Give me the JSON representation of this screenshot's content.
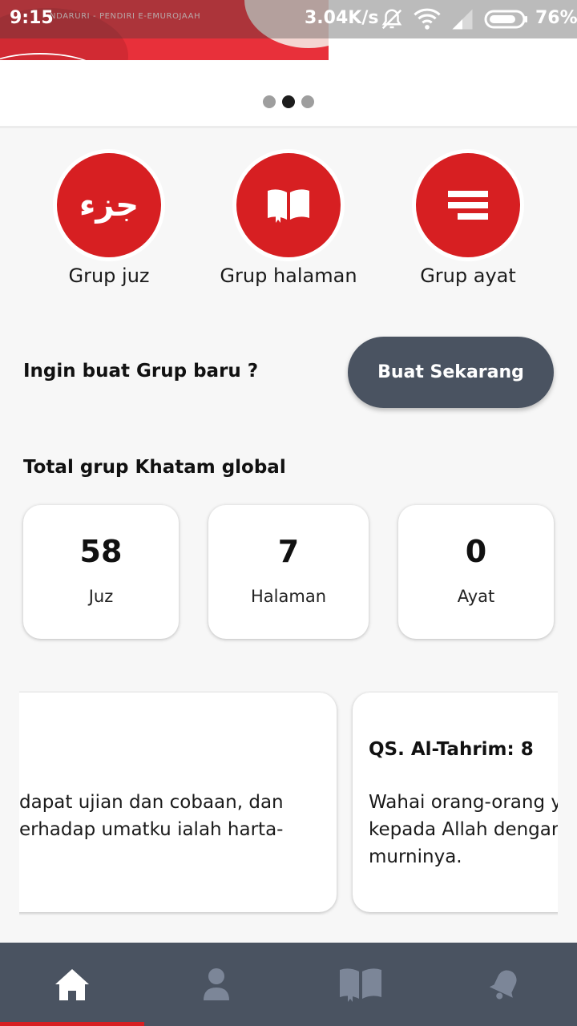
{
  "status_bar": {
    "time": "9:15",
    "speed": "3.04K/s",
    "battery": "76%"
  },
  "banner": {
    "caption": "NDARURI - PENDIRI E-EMUROJAAH",
    "slide_count": 3,
    "active_slide": 1
  },
  "groups": [
    {
      "label": "Grup juz",
      "icon": "juz-arabic-icon",
      "glyph": "جزء"
    },
    {
      "label": "Grup halaman",
      "icon": "open-book-icon"
    },
    {
      "label": "Grup ayat",
      "icon": "lines-icon"
    }
  ],
  "cta": {
    "question": "Ingin buat Grup baru ?",
    "button_label": "Buat Sekarang"
  },
  "totals": {
    "title": "Total grup Khatam global",
    "items": [
      {
        "value": "58",
        "label": "Juz"
      },
      {
        "value": "7",
        "label": "Halaman"
      },
      {
        "value": "0",
        "label": "Ayat"
      }
    ]
  },
  "quotes": [
    {
      "title": "",
      "lines": [
        "dapat ujian dan cobaan, dan",
        "erhadap umatku ialah harta-"
      ]
    },
    {
      "title": "QS. Al-Tahrim: 8",
      "lines": [
        "Wahai orang-orang y",
        "kepada Allah dengar",
        "murninya."
      ]
    }
  ],
  "bottom_nav": {
    "items": [
      "home-icon",
      "profile-icon",
      "quran-book-icon",
      "notification-bell-icon"
    ],
    "active": "home-icon"
  },
  "colors": {
    "accent": "#d71f22",
    "nav_bg": "#4a5361",
    "page_bg": "#f7f7f7"
  }
}
